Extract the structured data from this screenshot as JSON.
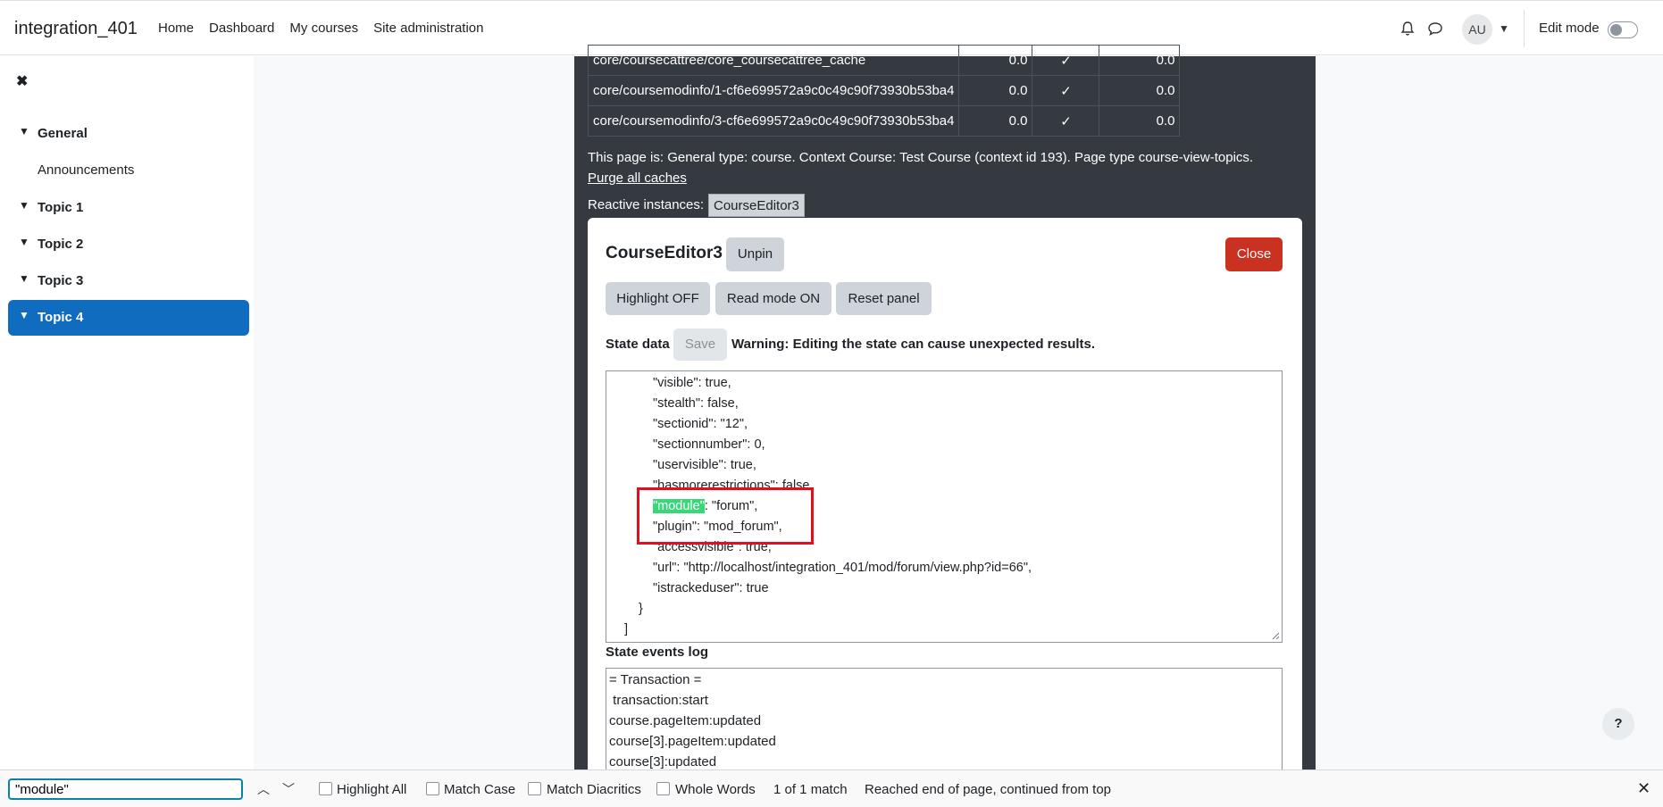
{
  "navbar": {
    "brand": "integration_401",
    "links": [
      "Home",
      "Dashboard",
      "My courses",
      "Site administration"
    ],
    "avatar": "AU",
    "edit_mode_label": "Edit mode",
    "edit_mode_on": false
  },
  "drawer": {
    "items": [
      {
        "label": "General"
      },
      {
        "label": "Announcements"
      },
      {
        "label": "Topic 1"
      },
      {
        "label": "Topic 2"
      },
      {
        "label": "Topic 3"
      },
      {
        "label": "Topic 4"
      }
    ]
  },
  "cache_table": {
    "rows": [
      {
        "name": "core/coursecattree/core_coursecattree_cache",
        "v1": "0.0",
        "check": "✓",
        "v2": "0.0"
      },
      {
        "name": "core/coursemodinfo/1-cf6e699572a9c0c49c90f73930b53ba4",
        "v1": "0.0",
        "check": "✓",
        "v2": "0.0"
      },
      {
        "name": "core/coursemodinfo/3-cf6e699572a9c0c49c90f73930b53ba4",
        "v1": "0.0",
        "check": "✓",
        "v2": "0.0"
      }
    ]
  },
  "page_info": "This page is: General type: course. Context Course: Test Course (context id 193). Page type course-view-topics.",
  "purge_link": "Purge all caches",
  "reactive_label": "Reactive instances:",
  "reactive_instance": "CourseEditor3",
  "panel": {
    "title": "CourseEditor3",
    "unpin": "Unpin",
    "close": "Close",
    "highlight": "Highlight OFF",
    "readmode": "Read mode ON",
    "reset": "Reset panel",
    "state_label": "State data",
    "save": "Save",
    "warning": "Warning: Editing the state can cause unexpected results.",
    "state_lines": [
      "\"visible\": true,",
      "\"stealth\": false,",
      "\"sectionid\": \"12\",",
      "\"sectionnumber\": 0,",
      "\"uservisible\": true,",
      "\"hasmorerestrictions\": false,",
      ": \"forum\",",
      "\"plugin\": \"mod_forum\",",
      "\"accessvisible\": true,",
      "\"url\": \"http://localhost/integration_401/mod/forum/view.php?id=66\",",
      "\"istrackeduser\": true",
      "}",
      "]"
    ],
    "highlighted_text": "\"module\"",
    "events_label": "State events log",
    "events_lines": [
      "= Transaction =",
      " transaction:start",
      "course.pageItem:updated",
      "course[3].pageItem:updated",
      "course[3]:updated"
    ]
  },
  "help_label": "?",
  "findbar": {
    "query": "\"module\"",
    "highlight_all": "Highlight All",
    "match_case": "Match Case",
    "match_diacritics": "Match Diacritics",
    "whole_words": "Whole Words",
    "match_count": "1 of 1 match",
    "status": "Reached end of page, continued from top"
  }
}
